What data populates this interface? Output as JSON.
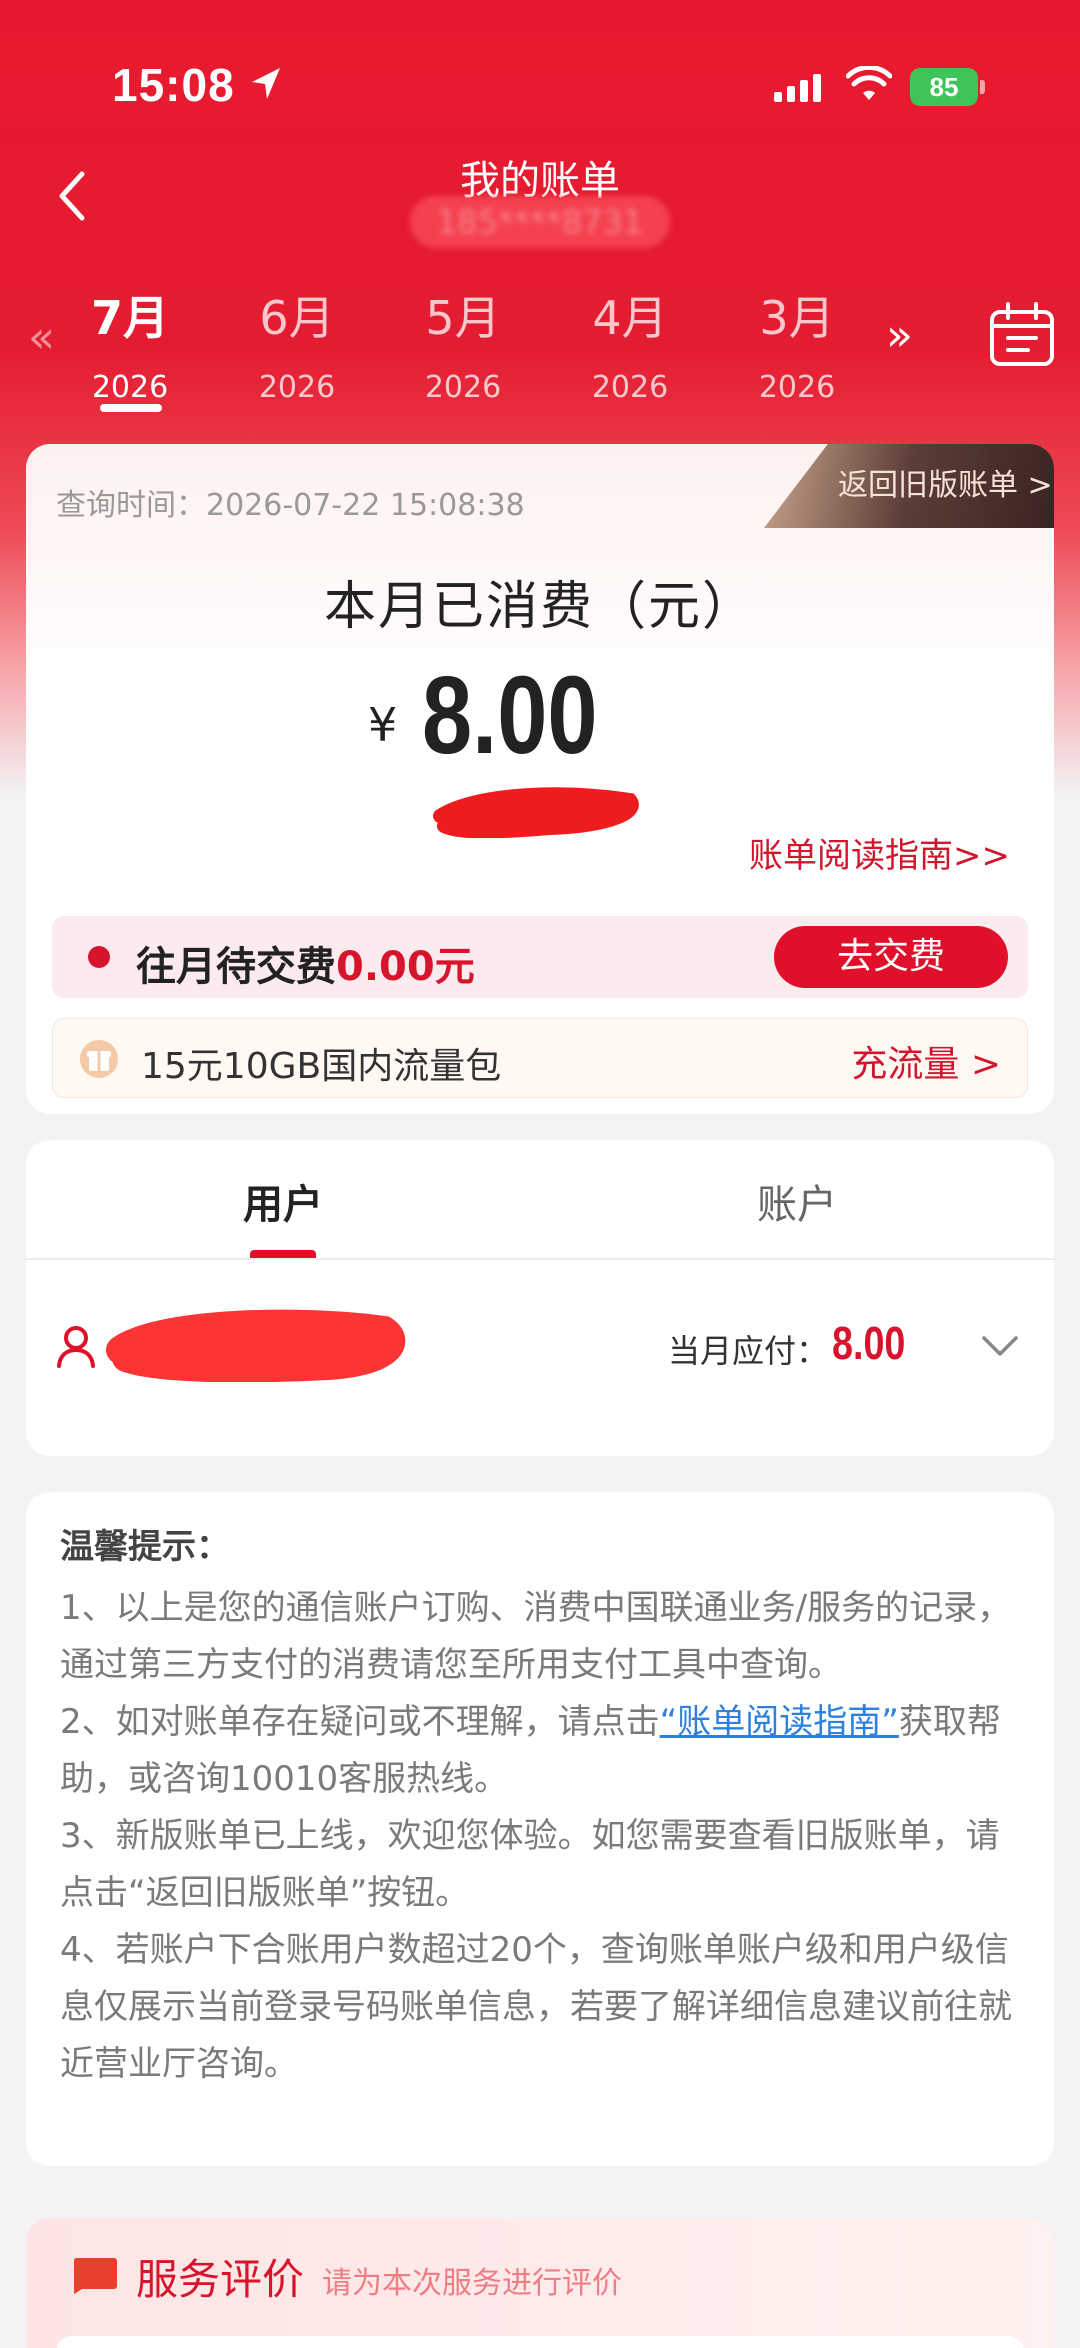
{
  "status_bar": {
    "time": "15:08",
    "battery": "85"
  },
  "header": {
    "title": "我的账单",
    "phone": "185****8731"
  },
  "month_tabs": {
    "prev_icon": "«",
    "next_icon": "»",
    "items": [
      {
        "month": "7月",
        "year": "2026",
        "active": true
      },
      {
        "month": "6月",
        "year": "2026",
        "active": false
      },
      {
        "month": "5月",
        "year": "2026",
        "active": false
      },
      {
        "month": "4月",
        "year": "2026",
        "active": false
      },
      {
        "month": "3月",
        "year": "2026",
        "active": false
      }
    ]
  },
  "bill_card": {
    "query_time": "查询时间：2026-07-22 15:08:38",
    "old_bill_link": "返回旧版账单 >",
    "consumed_label": "本月已消费（元）",
    "currency": "¥",
    "amount": "8.00",
    "guide_link": "账单阅读指南>>",
    "due_label": "往月待交费",
    "due_value": "0.00元",
    "pay_button": "去交费",
    "flow_text": "15元10GB国内流量包",
    "flow_link": "充流量 >"
  },
  "user_account": {
    "tabs": [
      "用户",
      "账户"
    ],
    "due_month_label": "当月应付：",
    "due_month_value": "8.00"
  },
  "tips": {
    "title": "温馨提示：",
    "item1": "1、以上是您的通信账户订购、消费中国联通业务/服务的记录，通过第三方支付的消费请您至所用支付工具中查询。",
    "item2_before": "2、如对账单存在疑问或不理解，请点击",
    "item2_link": "“账单阅读指南”",
    "item2_after": "获取帮助，或咨询10010客服热线。",
    "item3": "3、新版账单已上线，欢迎您体验。如您需要查看旧版账单，请点击“返回旧版账单”按钮。",
    "item4": "4、若账户下合账用户数超过20个，查询账单账户级和用户级信息仅展示当前登录号码账单信息，若要了解详细信息建议前往就近营业厅咨询。"
  },
  "service_eval": {
    "title": "服务评价",
    "subtitle": "请为本次服务进行评价"
  },
  "colors": {
    "brand_red": "#e0102b",
    "link_blue": "#2d7fe0"
  }
}
